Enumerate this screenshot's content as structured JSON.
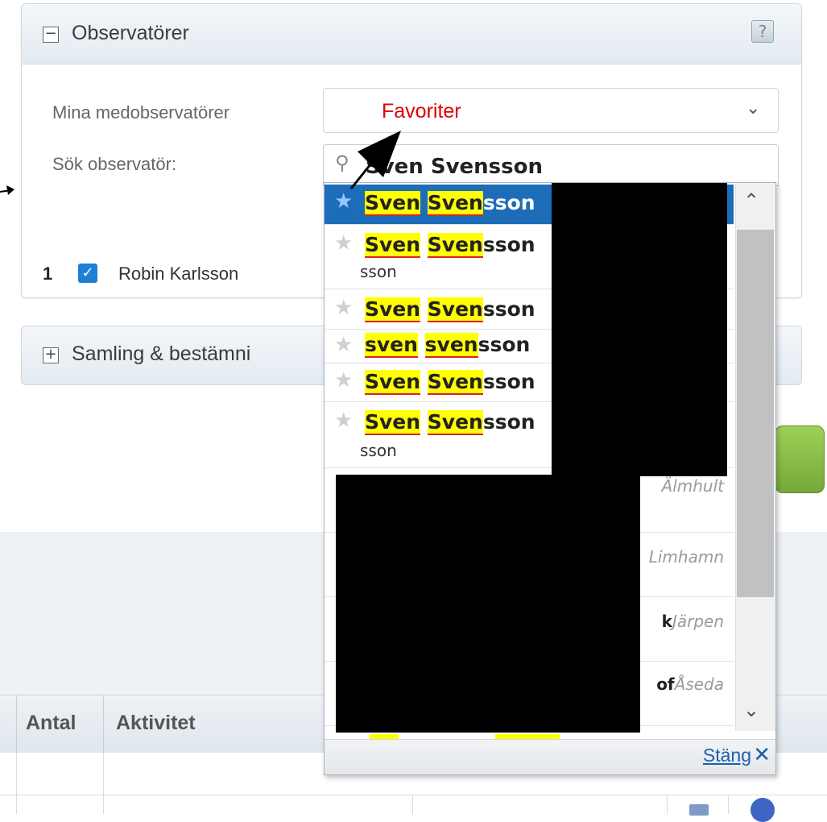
{
  "observers_panel": {
    "title": "Observatörer",
    "collapse_icon": "minus-box-icon",
    "help_icon_glyph": "?",
    "my_coobservers_label": "Mina medobservatörer",
    "my_coobservers_value": "",
    "search_label": "Sök observatör:",
    "search_value": "Sven Svensson",
    "observers": [
      {
        "index": "1",
        "name": "Robin Karlsson",
        "checked": true
      }
    ]
  },
  "collection_panel": {
    "title": "Samling & bestämni",
    "expand_icon": "plus-box-icon"
  },
  "dropdown": {
    "results": [
      {
        "first": "Sven",
        "last_hl": "Sven",
        "last_rest": "sson",
        "sub": "",
        "place": "",
        "favorite": true,
        "active": true
      },
      {
        "first": "Sven",
        "last_hl": "Sven",
        "last_rest": "sson",
        "sub": "sson",
        "place": "",
        "favorite": false,
        "active": false
      },
      {
        "first": "Sven",
        "last_hl": "Sven",
        "last_rest": "sson",
        "sub": "",
        "place": "",
        "favorite": false,
        "active": false
      },
      {
        "first": "sven",
        "last_hl": "sven",
        "last_rest": "sson",
        "sub": "",
        "place": "",
        "favorite": false,
        "active": false
      },
      {
        "first": "Sven",
        "last_hl": "Sven",
        "last_rest": "sson",
        "sub": "",
        "place": "",
        "favorite": false,
        "active": false
      },
      {
        "first": "Sven",
        "last_hl": "Sven",
        "last_rest": "sson",
        "sub": "sson",
        "place": "",
        "favorite": false,
        "active": false
      }
    ],
    "hidden_places": [
      {
        "suffix": "",
        "place": "Älmhult"
      },
      {
        "suffix": "",
        "place": "Limhamn"
      },
      {
        "suffix": "k",
        "place": "Järpen"
      },
      {
        "suffix": "of",
        "place": "Åseda"
      }
    ],
    "close_label": "Stäng",
    "close_icon": "close-x-icon"
  },
  "table": {
    "columns": [
      "Antal",
      "Aktivitet"
    ]
  },
  "annotation": {
    "favorites_label": "Favoriter"
  },
  "colors": {
    "highlight": "#ffff00",
    "active_row": "#1c6cb8",
    "annotation": "#e00000",
    "link": "#1c5fb0"
  }
}
